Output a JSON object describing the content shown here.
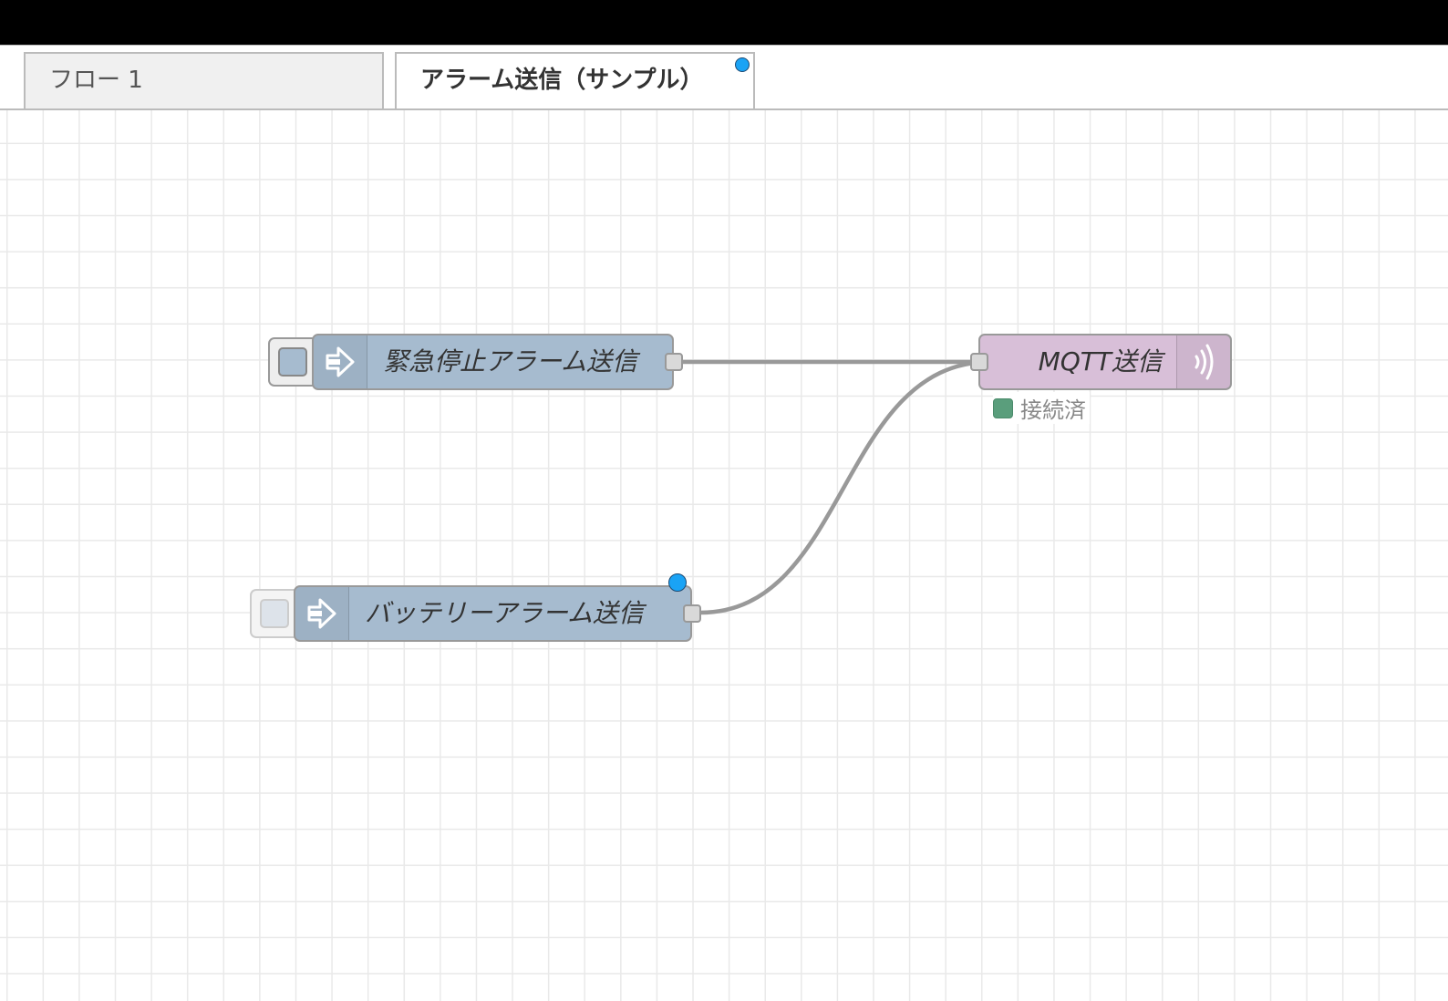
{
  "tabs": [
    {
      "label": "フロー 1",
      "active": false
    },
    {
      "label": "アラーム送信（サンプル）",
      "active": true,
      "changed": true
    }
  ],
  "nodes": {
    "emergency": {
      "type": "inject",
      "label": "緊急停止アラーム送信",
      "icon": "arrow-in-icon",
      "changed": false
    },
    "battery": {
      "type": "inject",
      "label": "バッテリーアラーム送信",
      "icon": "arrow-in-icon",
      "changed": true,
      "button_disabled": true
    },
    "mqtt": {
      "type": "mqtt out",
      "label": "MQTT送信",
      "icon": "bridge-icon",
      "status": {
        "text": "接続済",
        "color": "#5a9e7c"
      }
    }
  },
  "wires": [
    {
      "from": "emergency",
      "to": "mqtt"
    },
    {
      "from": "battery",
      "to": "mqtt"
    }
  ],
  "colors": {
    "inject_node": "#a6bbcf",
    "mqtt_node": "#d8bfd8",
    "changed_indicator": "#1aa3f5",
    "wire": "#999999",
    "status_connected": "#5a9e7c"
  }
}
